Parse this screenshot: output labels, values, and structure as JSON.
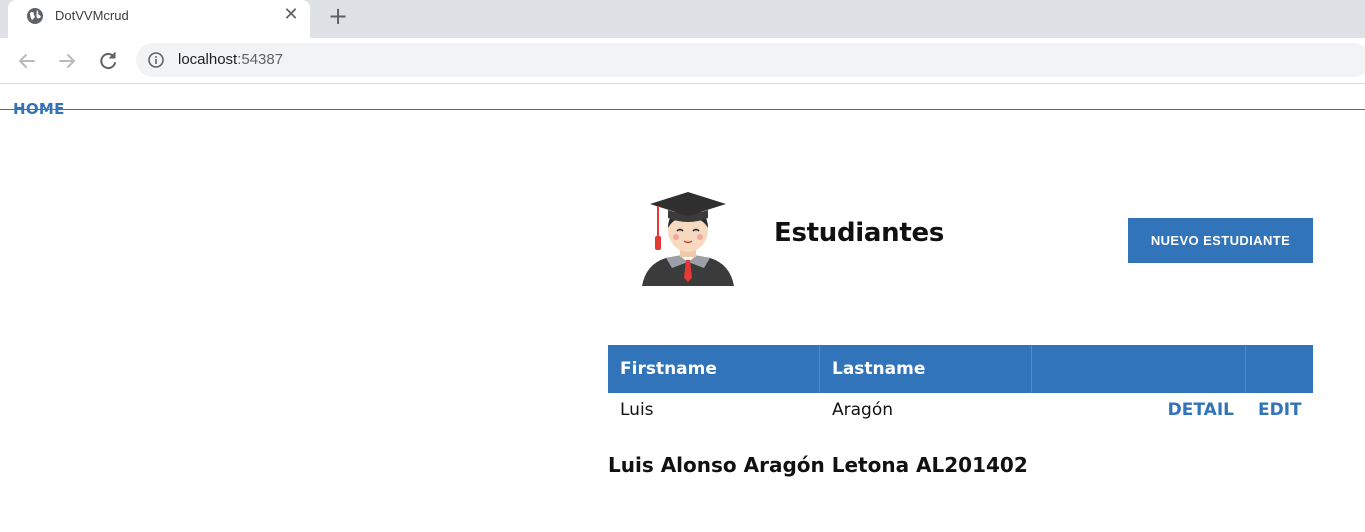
{
  "browser": {
    "tab_title": "DotVVMcrud",
    "url_host": "localhost",
    "url_port": ":54387"
  },
  "nav": {
    "home_label": "HOME"
  },
  "header": {
    "title": "Estudiantes",
    "new_button_label": "NUEVO ESTUDIANTE"
  },
  "table": {
    "columns": [
      "Firstname",
      "Lastname",
      "",
      ""
    ],
    "rows": [
      {
        "firstname": "Luis",
        "lastname": "Aragón",
        "detail_label": "DETAIL",
        "edit_label": "EDIT"
      }
    ]
  },
  "detail": {
    "text": "Luis Alonso Aragón Letona AL201402"
  },
  "colors": {
    "accent": "#3174b9"
  }
}
